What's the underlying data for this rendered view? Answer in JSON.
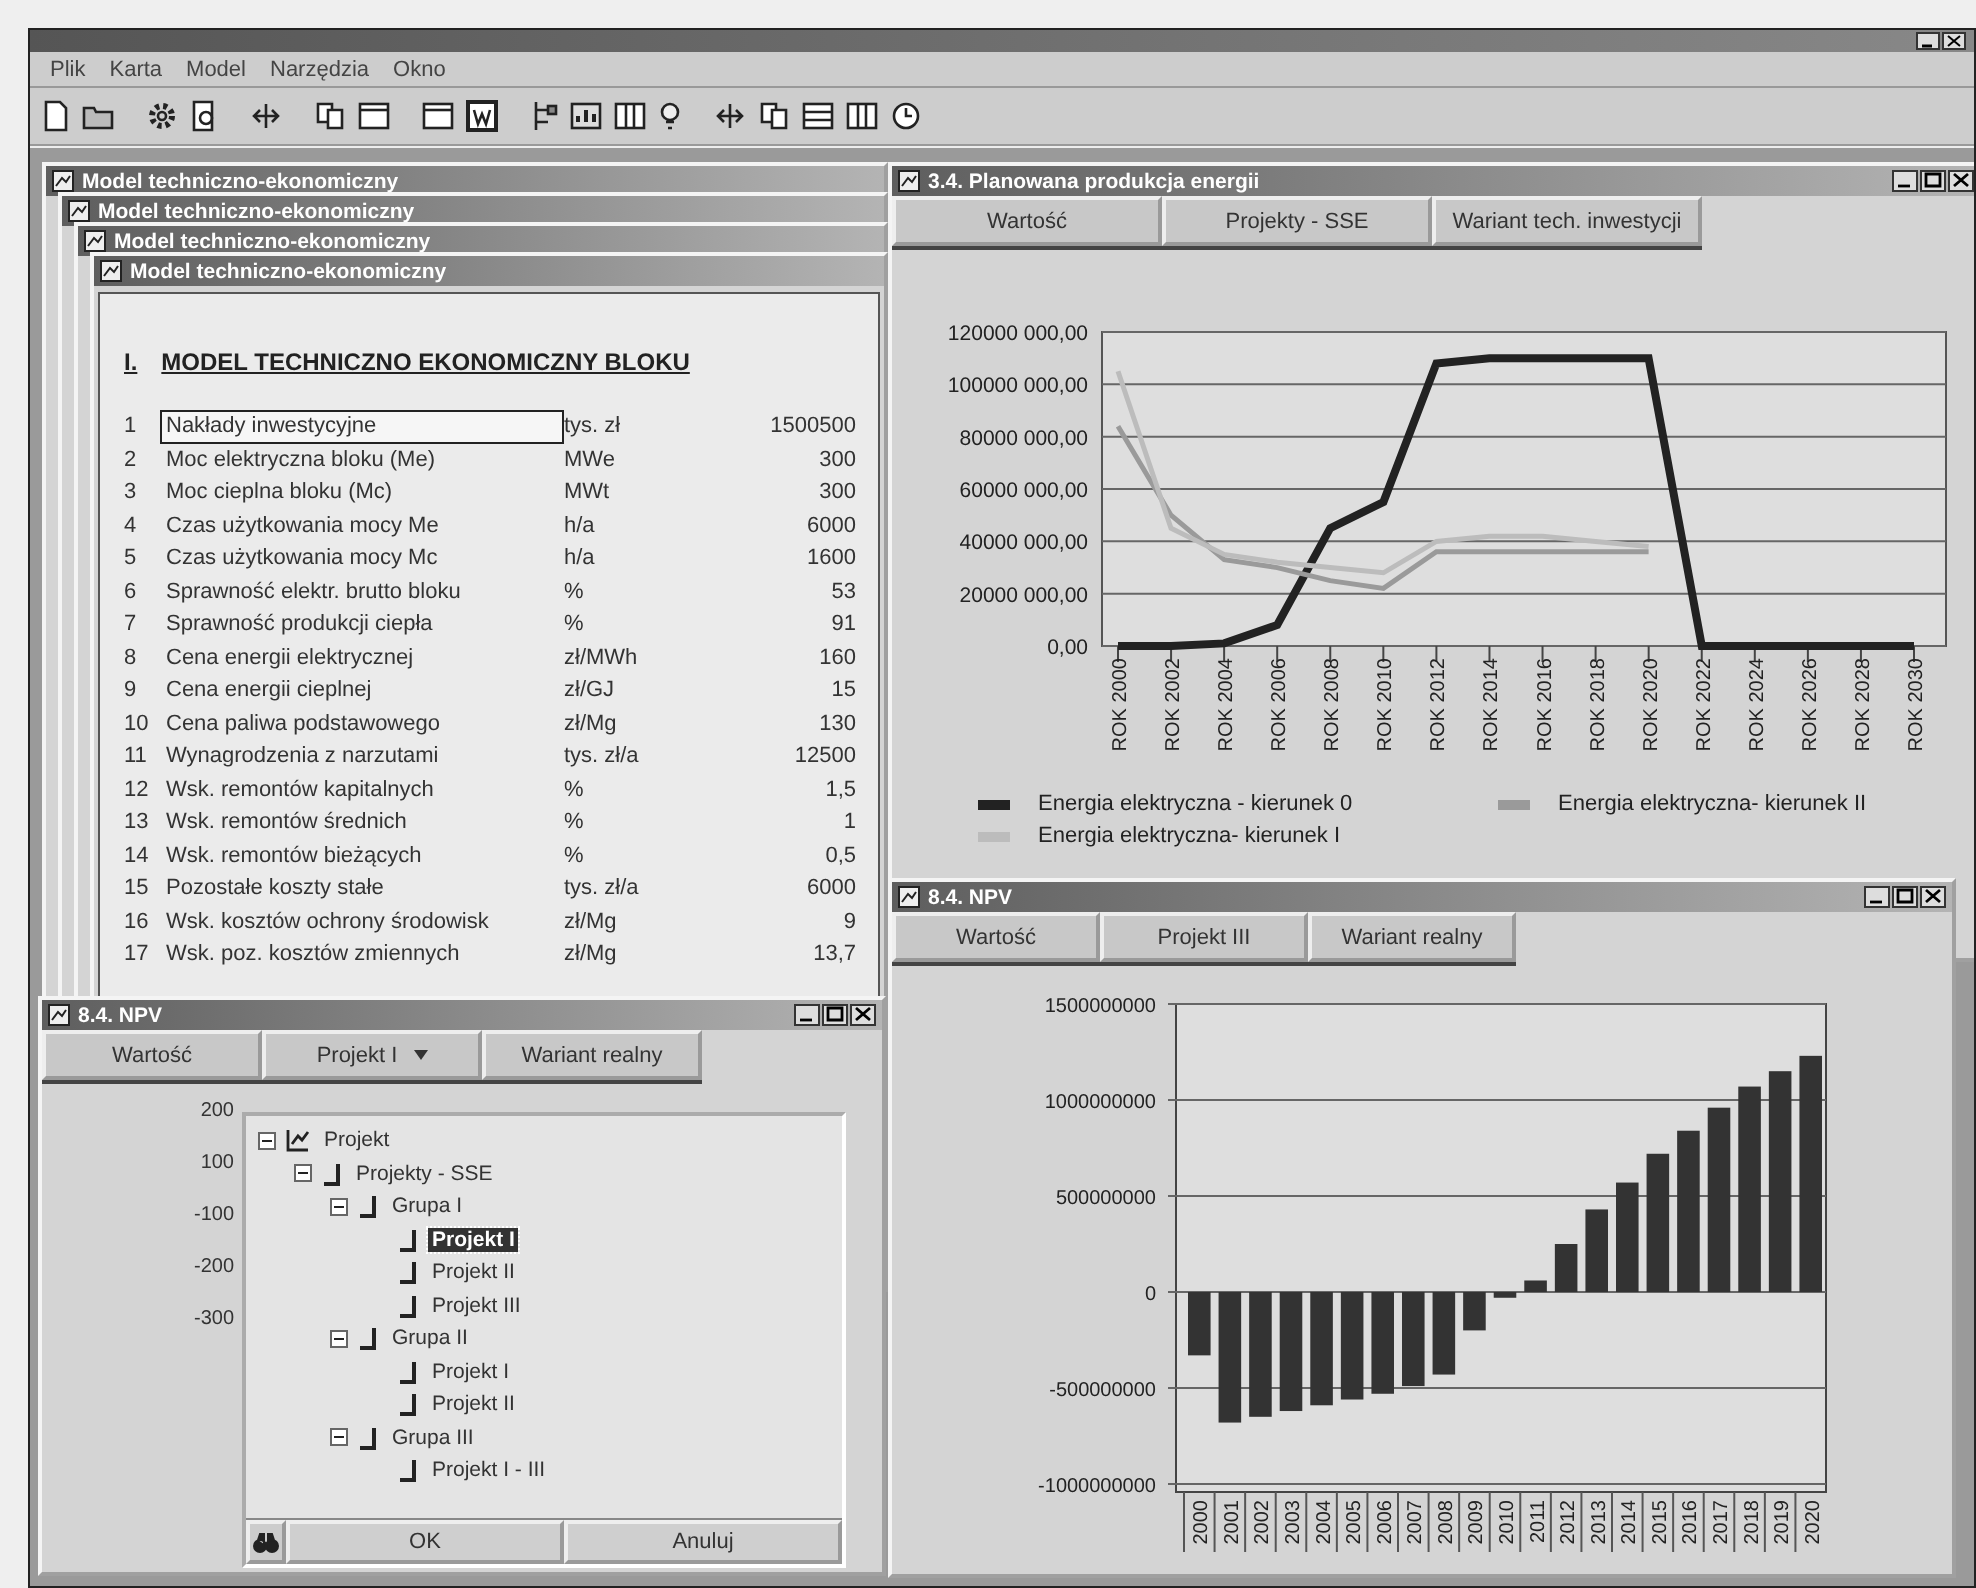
{
  "app": {
    "menu": [
      {
        "label": "Plik"
      },
      {
        "label": "Karta"
      },
      {
        "label": "Model"
      },
      {
        "label": "Narzędzia"
      },
      {
        "label": "Okno"
      }
    ]
  },
  "model_windows": [
    {
      "title": "Model techniczno-ekonomiczny"
    },
    {
      "title": "Model techniczno-ekonomiczny"
    },
    {
      "title": "Model techniczno-ekonomiczny"
    },
    {
      "title": "Model techniczno-ekonomiczny"
    }
  ],
  "model_sheet": {
    "number": "I.",
    "heading": "MODEL TECHNICZNO EKONOMICZNY BLOKU",
    "rows": [
      {
        "no": "1",
        "name": "Nakłady inwestycyjne",
        "unit": "tys. zł",
        "value": "1500500",
        "selected": true
      },
      {
        "no": "2",
        "name": "Moc elektryczna bloku (Me)",
        "unit": "MWe",
        "value": "300",
        "selected": false
      },
      {
        "no": "3",
        "name": "Moc cieplna bloku (Mc)",
        "unit": "MWt",
        "value": "300",
        "selected": false
      },
      {
        "no": "4",
        "name": "Czas użytkowania mocy Me",
        "unit": "h/a",
        "value": "6000",
        "selected": false
      },
      {
        "no": "5",
        "name": "Czas użytkowania mocy Mc",
        "unit": "h/a",
        "value": "1600",
        "selected": false
      },
      {
        "no": "6",
        "name": "Sprawność elektr. brutto bloku",
        "unit": "%",
        "value": "53",
        "selected": false
      },
      {
        "no": "7",
        "name": "Sprawność produkcji ciepła",
        "unit": "%",
        "value": "91",
        "selected": false
      },
      {
        "no": "8",
        "name": "Cena energii elektrycznej",
        "unit": "zł/MWh",
        "value": "160",
        "selected": false
      },
      {
        "no": "9",
        "name": "Cena energii cieplnej",
        "unit": "zł/GJ",
        "value": "15",
        "selected": false
      },
      {
        "no": "10",
        "name": "Cena paliwa podstawowego",
        "unit": "zł/Mg",
        "value": "130",
        "selected": false
      },
      {
        "no": "11",
        "name": "Wynagrodzenia z narzutami",
        "unit": "tys. zł/a",
        "value": "12500",
        "selected": false
      },
      {
        "no": "12",
        "name": "Wsk. remontów kapitalnych",
        "unit": "%",
        "value": "1,5",
        "selected": false
      },
      {
        "no": "13",
        "name": "Wsk. remontów średnich",
        "unit": "%",
        "value": "1",
        "selected": false
      },
      {
        "no": "14",
        "name": "Wsk. remontów bieżących",
        "unit": "%",
        "value": "0,5",
        "selected": false
      },
      {
        "no": "15",
        "name": "Pozostałe koszty stałe",
        "unit": "tys. zł/a",
        "value": "6000",
        "selected": false
      },
      {
        "no": "16",
        "name": "Wsk. kosztów ochrony środowisk",
        "unit": "zł/Mg",
        "value": "9",
        "selected": false
      },
      {
        "no": "17",
        "name": "Wsk. poz. kosztów zmiennych",
        "unit": "zł/Mg",
        "value": "13,7",
        "selected": false
      }
    ]
  },
  "energy_window": {
    "title": "3.4. Planowana produkcja energii",
    "tabs": [
      {
        "label": "Wartość"
      },
      {
        "label": "Projekty - SSE"
      },
      {
        "label": "Wariant tech. inwestycji"
      }
    ],
    "chart_data": {
      "type": "line",
      "grid": true,
      "categories": [
        "ROK 2000",
        "ROK 2002",
        "ROK 2004",
        "ROK 2006",
        "ROK 2008",
        "ROK 2010",
        "ROK 2012",
        "ROK 2014",
        "ROK 2016",
        "ROK 2018",
        "ROK 2020",
        "ROK 2022",
        "ROK 2024",
        "ROK 2026",
        "ROK 2028",
        "ROK 2030"
      ],
      "ylim": [
        0,
        120000000
      ],
      "yticks": [
        {
          "value": 0,
          "label": "0,00"
        },
        {
          "value": 20000000,
          "label": "20000 000,00"
        },
        {
          "value": 40000000,
          "label": "40000 000,00"
        },
        {
          "value": 60000000,
          "label": "60000 000,00"
        },
        {
          "value": 80000000,
          "label": "80000 000,00"
        },
        {
          "value": 100000000,
          "label": "100000 000,00"
        },
        {
          "value": 120000000,
          "label": "120000 000,00"
        }
      ],
      "series": [
        {
          "name": "Energia elektryczna - kierunek 0",
          "color": "#222222",
          "values": [
            0,
            0,
            1000000,
            8000000,
            45000000,
            55000000,
            108000000,
            110000000,
            110000000,
            110000000,
            110000000,
            0,
            0,
            0,
            0,
            0
          ]
        },
        {
          "name": "Energia elektryczna- kierunek II",
          "color": "#9a9a9a",
          "values": [
            84000000,
            50000000,
            33000000,
            30000000,
            25000000,
            22000000,
            36000000,
            36000000,
            36000000,
            36000000,
            36000000,
            null,
            null,
            null,
            null,
            null
          ]
        },
        {
          "name": "Energia elektryczna- kierunek I",
          "color": "#bcbcbc",
          "values": [
            105000000,
            45000000,
            35000000,
            32000000,
            30000000,
            28000000,
            40000000,
            42000000,
            42000000,
            40000000,
            38000000,
            null,
            null,
            null,
            null,
            null
          ]
        }
      ]
    }
  },
  "npv_left": {
    "title": "8.4. NPV",
    "tabs": [
      {
        "label": "Wartość",
        "dropdown": false
      },
      {
        "label": "Projekt I",
        "dropdown": true
      },
      {
        "label": "Wariant realny",
        "dropdown": false
      }
    ],
    "axis_labels": [
      "200",
      "100",
      "-100",
      "-200",
      "-300"
    ],
    "tree": [
      {
        "label": "Projekt",
        "expanded": true,
        "selected": false,
        "children": [
          {
            "label": "Projekty - SSE",
            "expanded": true,
            "selected": false,
            "children": [
              {
                "label": "Grupa I",
                "expanded": true,
                "selected": false,
                "children": [
                  {
                    "label": "Projekt I",
                    "selected": true
                  },
                  {
                    "label": "Projekt II",
                    "selected": false
                  },
                  {
                    "label": "Projekt III",
                    "selected": false
                  }
                ]
              },
              {
                "label": "Grupa II",
                "expanded": true,
                "selected": false,
                "children": [
                  {
                    "label": "Projekt I",
                    "selected": false
                  },
                  {
                    "label": "Projekt II",
                    "selected": false
                  }
                ]
              },
              {
                "label": "Grupa III",
                "expanded": true,
                "selected": false,
                "children": [
                  {
                    "label": "Projekt I - III",
                    "selected": false
                  }
                ]
              }
            ]
          }
        ]
      }
    ],
    "buttons": [
      {
        "kind": "icon"
      },
      {
        "kind": "text",
        "label": "OK"
      },
      {
        "kind": "text",
        "label": "Anuluj"
      }
    ]
  },
  "npv_right": {
    "title": "8.4. NPV",
    "tabs": [
      {
        "label": "Wartość"
      },
      {
        "label": "Projekt III"
      },
      {
        "label": "Wariant realny"
      }
    ],
    "chart_data": {
      "type": "bar",
      "grid": true,
      "categories": [
        "2000",
        "2001",
        "2002",
        "2003",
        "2004",
        "2005",
        "2006",
        "2007",
        "2008",
        "2009",
        "2010",
        "2011",
        "2012",
        "2013",
        "2014",
        "2015",
        "2016",
        "2017",
        "2018",
        "2019",
        "2020"
      ],
      "values": [
        -330000000,
        -680000000,
        -650000000,
        -620000000,
        -590000000,
        -560000000,
        -530000000,
        -490000000,
        -430000000,
        -200000000,
        -30000000,
        60000000,
        250000000,
        430000000,
        570000000,
        720000000,
        840000000,
        960000000,
        1070000000,
        1150000000,
        1230000000
      ],
      "ylim": [
        -1000000000,
        1500000000
      ],
      "yticks": [
        {
          "value": -1000000000,
          "label": "-1000000000"
        },
        {
          "value": -500000000,
          "label": "-500000000"
        },
        {
          "value": 0,
          "label": "0"
        },
        {
          "value": 500000000,
          "label": "500000000"
        },
        {
          "value": 1000000000,
          "label": "1000000000"
        },
        {
          "value": 1500000000,
          "label": "1500000000"
        }
      ]
    }
  }
}
